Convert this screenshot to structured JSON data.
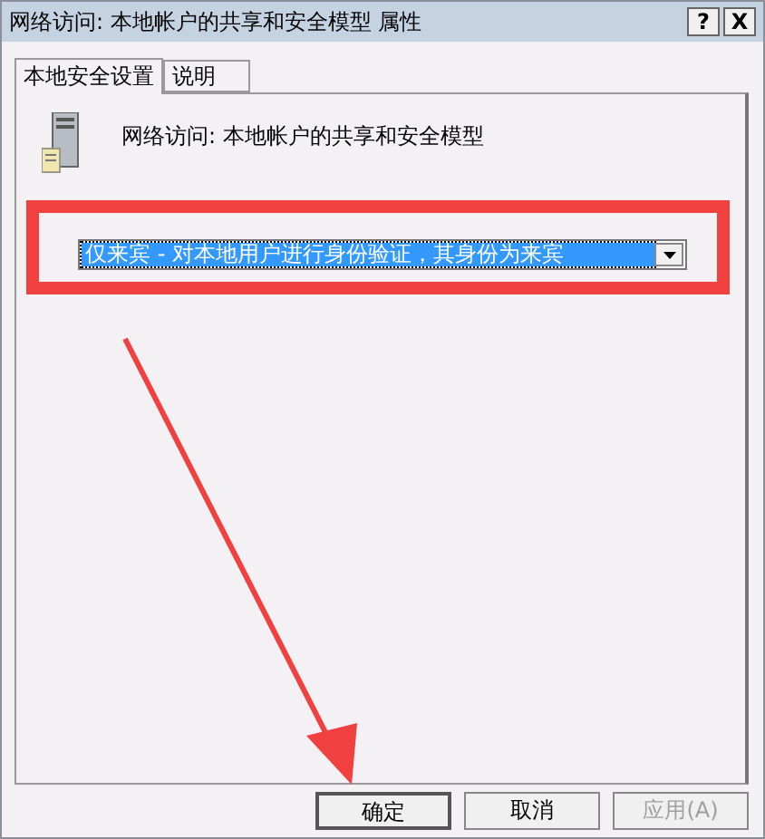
{
  "window": {
    "title": "网络访问: 本地帐户的共享和安全模型 属性",
    "help_glyph": "?",
    "close_glyph": "X"
  },
  "tabs": [
    {
      "label": "本地安全设置",
      "selected": true
    },
    {
      "label": "说明",
      "selected": false
    }
  ],
  "policy_name": "网络访问: 本地帐户的共享和安全模型",
  "dropdown": {
    "value": "仅来宾 - 对本地用户进行身份验证，其身份为来宾",
    "focused": true
  },
  "buttons": [
    {
      "label": "确定",
      "disabled": false,
      "default": true
    },
    {
      "label": "取消",
      "disabled": false,
      "default": false
    },
    {
      "label": "应用(A)",
      "disabled": true,
      "default": false
    }
  ]
}
